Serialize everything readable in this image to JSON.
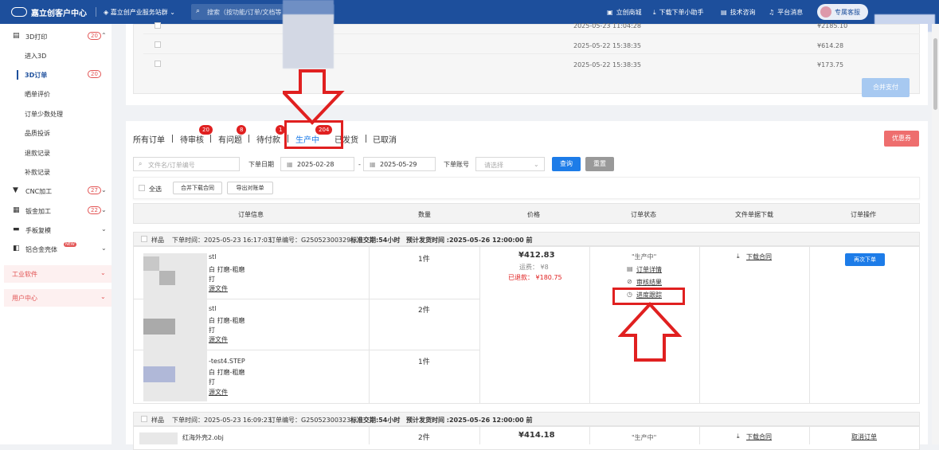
{
  "topbar": {
    "brand": "嘉立创客户中心",
    "group": "嘉立创产业服务站群",
    "search_placeholder": "搜索（按功能/订单/文档等",
    "nav": [
      "立创商城",
      "下载下单小助手",
      "技术咨询",
      "平台消息"
    ],
    "user_btn": "专属客服"
  },
  "sidebar": {
    "items": [
      {
        "label": "3D打印",
        "badge": "20",
        "icon": "printer-icon"
      },
      {
        "label": "进入3D"
      },
      {
        "label": "3D订单",
        "badge": "20"
      },
      {
        "label": "晒单评价"
      },
      {
        "label": "订单少数处理"
      },
      {
        "label": "品质投诉"
      },
      {
        "label": "退款记录"
      },
      {
        "label": "补款记录"
      },
      {
        "label": "CNC加工",
        "badge": "27",
        "icon": "cnc-icon"
      },
      {
        "label": "钣金加工",
        "badge": "22",
        "icon": "sheet-icon"
      },
      {
        "label": "手板复模",
        "icon": "mold-icon"
      },
      {
        "label": "铝合金壳体",
        "tag": "NEW",
        "icon": "shell-icon"
      }
    ],
    "sections": [
      "工业软件",
      "用户中心"
    ]
  },
  "top_table": {
    "rows": [
      {
        "date": "2025-05-23 11:04:28",
        "amount": "¥2185.10"
      },
      {
        "date": "2025-05-22 15:38:35",
        "amount": "¥614.28"
      },
      {
        "date": "2025-05-22 15:38:35",
        "amount": "¥173.75"
      }
    ],
    "merge_pay": "合并支付"
  },
  "tabs": [
    {
      "label": "所有订单"
    },
    {
      "label": "待审核",
      "badge": "20"
    },
    {
      "label": "有问题",
      "badge": "8"
    },
    {
      "label": "待付款",
      "badge": "1"
    },
    {
      "label": "生产中",
      "badge": "204"
    },
    {
      "label": "已发货"
    },
    {
      "label": "已取消"
    }
  ],
  "coupon": "优惠券",
  "filters": {
    "file_placeholder": "文件名/订单编号",
    "date_label": "下单日期",
    "date_from": "2025-02-28",
    "date_to": "2025-05-29",
    "account_label": "下单账号",
    "account_placeholder": "请选择",
    "query": "查询",
    "reset": "重置",
    "dash": "-"
  },
  "bulk": {
    "select_all": "全选",
    "merge_download": "合并下载合同",
    "export": "导出对账单"
  },
  "headers": [
    "订单信息",
    "数量",
    "价格",
    "订单状态",
    "文件单据下载",
    "订单操作"
  ],
  "orders": [
    {
      "type": "样品",
      "time": "下单时间：2025-05-23 16:17:03",
      "no": "订单编号：G25052300329",
      "lead": "标准交期:54小时",
      "ship": "预计发货时间 :2025-05-26 12:00:00 前",
      "items": [
        {
          "name": "stl",
          "spec": "白 打磨-粗磨",
          "spec2": "打",
          "link": "源文件",
          "qty": "1件"
        },
        {
          "name": "stl",
          "spec": "白 打磨-粗磨",
          "spec2": "打",
          "link": "源文件",
          "qty": "2件"
        },
        {
          "name": "-test4.STEP",
          "spec": "白 打磨-粗磨",
          "spec2": "打",
          "link": "源文件",
          "qty": "1件"
        }
      ],
      "price": "¥412.83",
      "freight": "运费：  ¥8",
      "refund": "已退款：  ¥180.75",
      "status": "\"生产中\"",
      "links": [
        "订单详情",
        "审核结果",
        "进度跟踪"
      ],
      "download": "下载合同",
      "action": "再次下单"
    },
    {
      "type": "样品",
      "time": "下单时间：2025-05-23 16:09:23",
      "no": "订单编号：G25052300323",
      "lead": "标准交期:54小时",
      "ship": "预计发货时间 :2025-05-26 12:00:00 前",
      "items": [
        {
          "name": "红海外壳2.obj",
          "qty": "2件"
        }
      ],
      "price": "¥414.18",
      "status": "\"生产中\"",
      "download": "下载合同",
      "action": "取消订单"
    }
  ],
  "colors": {
    "brand": "#1d4f9c",
    "accent": "#1d7ce8",
    "alert": "#e02020"
  }
}
